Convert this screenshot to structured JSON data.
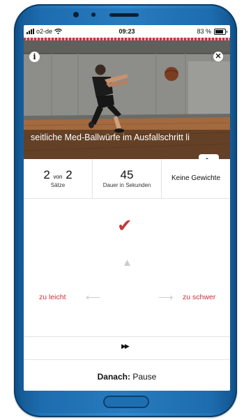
{
  "status_bar": {
    "carrier": "o2-de",
    "time": "09:23",
    "battery": "83 %",
    "battery_level": 0.83
  },
  "exercise": {
    "title": "seitliche Med-Ballwürfe im Ausfallschritt li"
  },
  "stats": {
    "sets_current": "2",
    "sets_joiner": "von",
    "sets_total": "2",
    "sets_label": "Sätze",
    "duration_value": "45",
    "duration_label": "Dauer in Sekunden",
    "weights_label": "Keine Gewichte"
  },
  "feedback": {
    "too_easy": "zu leicht",
    "too_hard": "zu schwer"
  },
  "next": {
    "prefix": "Danach:",
    "value": "Pause"
  },
  "colors": {
    "accent": "#c8323a",
    "phone_frame": "#1f74b8"
  },
  "icons": [
    "info-icon",
    "close-icon",
    "youtube-play-icon",
    "checkmark-icon",
    "arrow-up-icon",
    "arrow-left-icon",
    "arrow-right-icon",
    "fast-forward-icon",
    "wifi-icon",
    "battery-icon",
    "signal-icon"
  ]
}
